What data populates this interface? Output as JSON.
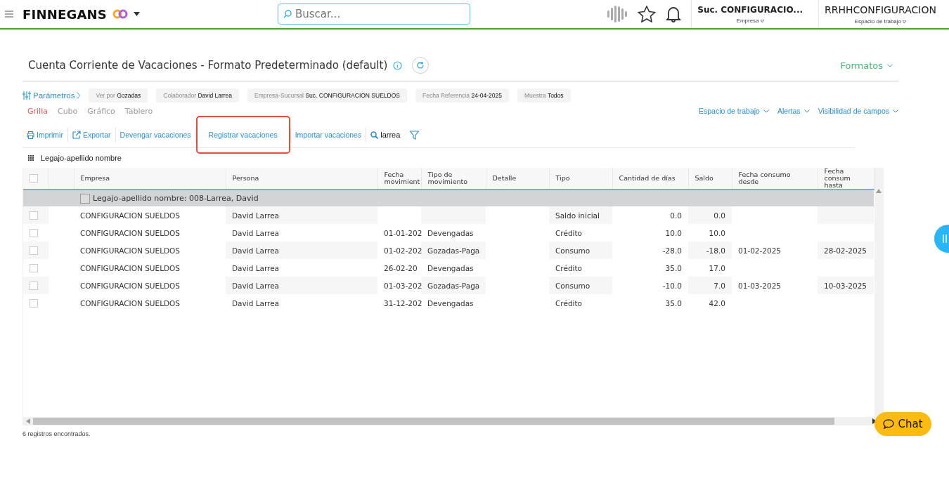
{
  "topbar": {
    "brand": "FINNEGANS",
    "search": {
      "placeholder": "Buscar..."
    },
    "company": {
      "value": "Suc. CONFIGURACIO...",
      "label": "Empresa"
    },
    "workspace": {
      "value": "RRHHCONFIGURACION",
      "label": "Espacio de trabajo"
    }
  },
  "title": "Cuenta Corriente de Vacaciones - Formato Predeterminado (default)",
  "formats": "Formatos",
  "params": {
    "label": "Parámetros",
    "filters": [
      {
        "label": "Ver por",
        "value": "Gozadas"
      },
      {
        "label": "Colaborador",
        "value": "David Larrea"
      },
      {
        "label": "Empresa-Sucursal",
        "value": "Suc. CONFIGURACION SUELDOS"
      },
      {
        "label": "Fecha Referencia",
        "value": "24-04-2025"
      },
      {
        "label": "Muestra",
        "value": "Todos"
      }
    ]
  },
  "view_tabs": [
    {
      "label": "Grilla",
      "selected": true
    },
    {
      "label": "Cubo",
      "selected": false
    },
    {
      "label": "Gráfico",
      "selected": false
    },
    {
      "label": "Tablero",
      "selected": false
    }
  ],
  "right_menus": [
    "Espacio de trabajo",
    "Alertas",
    "Visibilidad de campos"
  ],
  "toolbar": [
    {
      "kind": "print",
      "label": "Imprimir",
      "highlighted": false
    },
    {
      "kind": "export",
      "label": "Exportar",
      "highlighted": false
    },
    {
      "kind": "plain",
      "label": "Devengar vacaciones",
      "highlighted": false
    },
    {
      "kind": "plain",
      "label": "Registrar vacaciones",
      "highlighted": true
    },
    {
      "kind": "plain",
      "label": "Importar vacaciones",
      "highlighted": false
    }
  ],
  "search_term": "larrea",
  "grouping": "Legajo-apellido nombre",
  "table": {
    "columns": [
      "Empresa",
      "Persona",
      "Fecha movimient",
      "Tipo de movimiento",
      "Detalle",
      "Tipo",
      "Cantidad de días",
      "Saldo",
      "Fecha consumo desde",
      "Fecha consum hasta"
    ],
    "header_checked": false,
    "group": {
      "label": "Legajo-apellido nombre: 008-Larrea, David",
      "checked": false
    },
    "rows": [
      {
        "checked": false,
        "cells": [
          "CONFIGURACION SUELDOS",
          "David Larrea",
          "",
          "",
          "",
          "Saldo inicial",
          "0.0",
          "0.0",
          "",
          ""
        ]
      },
      {
        "checked": false,
        "cells": [
          "CONFIGURACION SUELDOS",
          "David Larrea",
          "01-01-202",
          "Devengadas",
          "",
          "Crédito",
          "10.0",
          "10.0",
          "",
          ""
        ]
      },
      {
        "checked": false,
        "cells": [
          "CONFIGURACION SUELDOS",
          "David Larrea",
          "01-02-202",
          "Gozadas-Paga",
          "",
          "Consumo",
          "-28.0",
          "-18.0",
          "01-02-2025",
          "28-02-2025"
        ]
      },
      {
        "checked": false,
        "cells": [
          "CONFIGURACION SUELDOS",
          "David Larrea",
          "26-02-20",
          "Devengadas",
          "",
          "Crédito",
          "35.0",
          "17.0",
          "",
          ""
        ]
      },
      {
        "checked": false,
        "cells": [
          "CONFIGURACION SUELDOS",
          "David Larrea",
          "01-03-202",
          "Gozadas-Paga",
          "",
          "Consumo",
          "-10.0",
          "7.0",
          "01-03-2025",
          "10-03-2025"
        ]
      },
      {
        "checked": false,
        "cells": [
          "CONFIGURACION SUELDOS",
          "David Larrea",
          "31-12-202",
          "Devengadas",
          "",
          "Crédito",
          "35.0",
          "42.0",
          "",
          ""
        ]
      }
    ]
  },
  "status": "6 registros encontrados.",
  "chat": "Chat"
}
